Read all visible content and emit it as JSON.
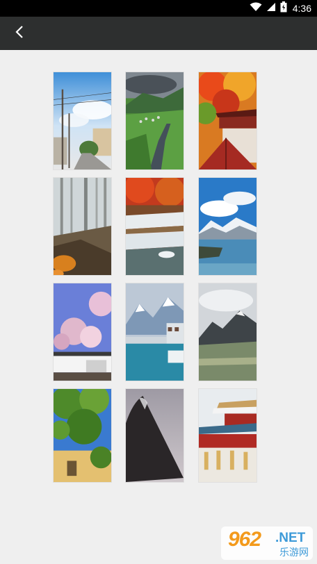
{
  "status_bar": {
    "time": "4:36",
    "icons": [
      "wifi-icon",
      "signal-icon",
      "battery-icon"
    ]
  },
  "app_bar": {
    "back_icon": "chevron-left-icon"
  },
  "wallpapers": [
    {
      "scene": "japanese-street-with-power-poles"
    },
    {
      "scene": "green-valley-river"
    },
    {
      "scene": "autumn-maple-temple-roof"
    },
    {
      "scene": "misty-forest-path"
    },
    {
      "scene": "waterfall-red-trees"
    },
    {
      "scene": "snowy-mountain-lake"
    },
    {
      "scene": "cherry-blossom-wall"
    },
    {
      "scene": "alpine-lake-village-winter"
    },
    {
      "scene": "mountain-meadow"
    },
    {
      "scene": "green-tree-building"
    },
    {
      "scene": "mount-fuji-silhouette"
    },
    {
      "scene": "forbidden-city-snow"
    }
  ],
  "watermark": {
    "logo": "962",
    "domain": ".NET",
    "subtitle": "乐游网"
  }
}
